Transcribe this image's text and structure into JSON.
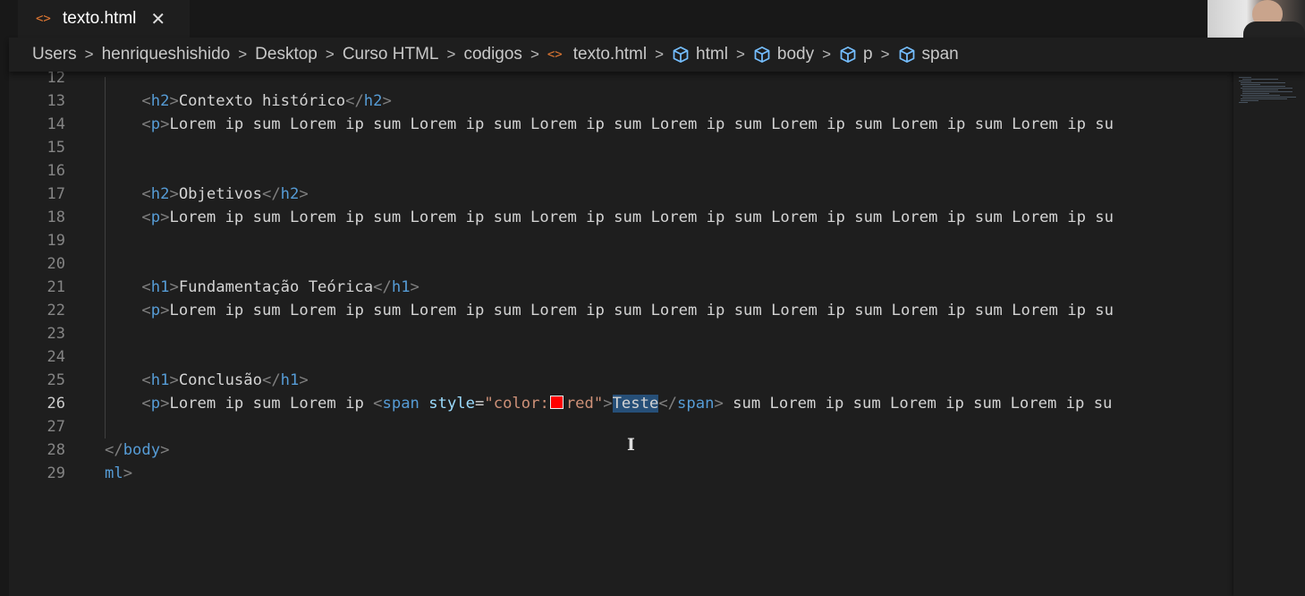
{
  "tab": {
    "icon": "<>",
    "title": "texto.html",
    "close": "✕"
  },
  "breadcrumb": [
    {
      "label": "Users",
      "icon": ""
    },
    {
      "label": "henriqueshishido",
      "icon": ""
    },
    {
      "label": "Desktop",
      "icon": ""
    },
    {
      "label": "Curso HTML",
      "icon": ""
    },
    {
      "label": "codigos",
      "icon": ""
    },
    {
      "label": "texto.html",
      "icon": "html-file-icon"
    },
    {
      "label": "html",
      "icon": "symbol-element-icon"
    },
    {
      "label": "body",
      "icon": "symbol-element-icon"
    },
    {
      "label": "p",
      "icon": "symbol-element-icon"
    },
    {
      "label": "span",
      "icon": "symbol-element-icon"
    }
  ],
  "breadcrumb_separator": ">",
  "editor": {
    "active_line": "26",
    "lines": [
      {
        "num": "12",
        "tokens": []
      },
      {
        "num": "13",
        "tokens": [
          [
            "    ",
            "t-text"
          ],
          [
            "<",
            "t-punc"
          ],
          [
            "h2",
            "t-tag"
          ],
          [
            ">",
            "t-punc"
          ],
          [
            "Contexto histórico",
            "t-text"
          ],
          [
            "</",
            "t-punc"
          ],
          [
            "h2",
            "t-tag"
          ],
          [
            ">",
            "t-punc"
          ]
        ]
      },
      {
        "num": "14",
        "tokens": [
          [
            "    ",
            "t-text"
          ],
          [
            "<",
            "t-punc"
          ],
          [
            "p",
            "t-tag"
          ],
          [
            ">",
            "t-punc"
          ],
          [
            "Lorem ip sum Lorem ip sum Lorem ip sum Lorem ip sum Lorem ip sum Lorem ip sum Lorem ip sum Lorem ip su",
            "t-text"
          ]
        ]
      },
      {
        "num": "15",
        "tokens": []
      },
      {
        "num": "16",
        "tokens": []
      },
      {
        "num": "17",
        "tokens": [
          [
            "    ",
            "t-text"
          ],
          [
            "<",
            "t-punc"
          ],
          [
            "h2",
            "t-tag"
          ],
          [
            ">",
            "t-punc"
          ],
          [
            "Objetivos",
            "t-text"
          ],
          [
            "</",
            "t-punc"
          ],
          [
            "h2",
            "t-tag"
          ],
          [
            ">",
            "t-punc"
          ]
        ]
      },
      {
        "num": "18",
        "tokens": [
          [
            "    ",
            "t-text"
          ],
          [
            "<",
            "t-punc"
          ],
          [
            "p",
            "t-tag"
          ],
          [
            ">",
            "t-punc"
          ],
          [
            "Lorem ip sum Lorem ip sum Lorem ip sum Lorem ip sum Lorem ip sum Lorem ip sum Lorem ip sum Lorem ip su",
            "t-text"
          ]
        ]
      },
      {
        "num": "19",
        "tokens": []
      },
      {
        "num": "20",
        "tokens": []
      },
      {
        "num": "21",
        "tokens": [
          [
            "    ",
            "t-text"
          ],
          [
            "<",
            "t-punc"
          ],
          [
            "h1",
            "t-tag"
          ],
          [
            ">",
            "t-punc"
          ],
          [
            "Fundamentação Teórica",
            "t-text"
          ],
          [
            "</",
            "t-punc"
          ],
          [
            "h1",
            "t-tag"
          ],
          [
            ">",
            "t-punc"
          ]
        ]
      },
      {
        "num": "22",
        "tokens": [
          [
            "    ",
            "t-text"
          ],
          [
            "<",
            "t-punc"
          ],
          [
            "p",
            "t-tag"
          ],
          [
            ">",
            "t-punc"
          ],
          [
            "Lorem ip sum Lorem ip sum Lorem ip sum Lorem ip sum Lorem ip sum Lorem ip sum Lorem ip sum Lorem ip su",
            "t-text"
          ]
        ]
      },
      {
        "num": "23",
        "tokens": []
      },
      {
        "num": "24",
        "tokens": []
      },
      {
        "num": "25",
        "tokens": [
          [
            "    ",
            "t-text"
          ],
          [
            "<",
            "t-punc"
          ],
          [
            "h1",
            "t-tag"
          ],
          [
            ">",
            "t-punc"
          ],
          [
            "Conclusão",
            "t-text"
          ],
          [
            "</",
            "t-punc"
          ],
          [
            "h1",
            "t-tag"
          ],
          [
            ">",
            "t-punc"
          ]
        ]
      },
      {
        "num": "26",
        "tokens": [
          [
            "    ",
            "t-text"
          ],
          [
            "<",
            "t-punc"
          ],
          [
            "p",
            "t-tag"
          ],
          [
            ">",
            "t-punc"
          ],
          [
            "Lorem ip sum Lorem ip ",
            "t-text"
          ],
          [
            "<",
            "t-punc"
          ],
          [
            "span",
            "t-tag"
          ],
          [
            " ",
            "t-text"
          ],
          [
            "style",
            "t-attr"
          ],
          [
            "=",
            "t-text"
          ],
          [
            "\"color:",
            "t-str"
          ],
          [
            "",
            "swatch"
          ],
          [
            "red\"",
            "t-str"
          ],
          [
            ">",
            "t-punc"
          ],
          [
            "Teste",
            "sel"
          ],
          [
            "</",
            "t-punc"
          ],
          [
            "span",
            "t-tag"
          ],
          [
            ">",
            "t-punc"
          ],
          [
            " sum Lorem ip sum Lorem ip sum Lorem ip su",
            "t-text"
          ]
        ]
      },
      {
        "num": "27",
        "tokens": []
      },
      {
        "num": "28",
        "tokens": [
          [
            "</",
            "t-punc"
          ],
          [
            "body",
            "t-tag"
          ],
          [
            ">",
            "t-punc"
          ]
        ]
      },
      {
        "num": "29",
        "tokens": [
          [
            "ml",
            "t-tag"
          ],
          [
            ">",
            "t-punc"
          ]
        ]
      }
    ]
  },
  "colors": {
    "background": "#1e1e1e",
    "tag": "#569cd6",
    "attribute": "#9cdcfe",
    "string": "#ce9178",
    "text": "#d4d4d4",
    "selection": "#264f78",
    "swatch_red": "#ff0000",
    "file_icon": "#e37933",
    "breadcrumb_icon": "#75beff"
  }
}
